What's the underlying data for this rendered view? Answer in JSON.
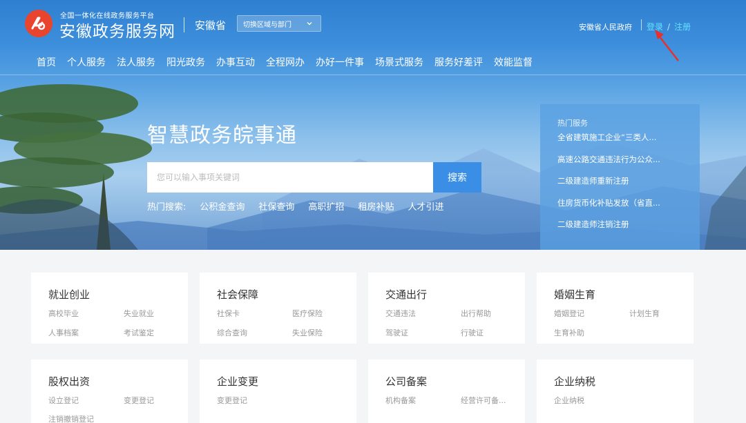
{
  "header": {
    "logo_subtitle": "全国一体化在线政务服务平台",
    "logo_title": "安徽政务服务网",
    "province": "安徽省",
    "region_switch": "切换区域与部门",
    "gov_link": "安徽省人民政府",
    "login": "登录",
    "register": "注册",
    "separator": "/"
  },
  "nav": [
    "首页",
    "个人服务",
    "法人服务",
    "阳光政务",
    "办事互动",
    "全程网办",
    "办好一件事",
    "场景式服务",
    "服务好差评",
    "效能监督"
  ],
  "hero": {
    "title": "智慧政务皖事通",
    "search_placeholder": "您可以输入事项关键词",
    "search_button": "搜索",
    "hot_label": "热门搜索:",
    "hot_terms": [
      "公积金查询",
      "社保查询",
      "高职扩招",
      "租房补贴",
      "人才引进"
    ]
  },
  "hot_services": {
    "title": "热门服务",
    "items": [
      "全省建筑施工企业“三类人...",
      "高速公路交通违法行为公众...",
      "二级建造师重新注册",
      "住房货币化补贴发放（省直...",
      "二级建造师注销注册"
    ]
  },
  "cards": [
    {
      "title": "就业创业",
      "links": [
        "高校毕业",
        "失业就业",
        "人事档案",
        "考试鉴定"
      ]
    },
    {
      "title": "社会保障",
      "links": [
        "社保卡",
        "医疗保险",
        "综合查询",
        "失业保险"
      ]
    },
    {
      "title": "交通出行",
      "links": [
        "交通违法",
        "出行帮助",
        "驾驶证",
        "行驶证"
      ]
    },
    {
      "title": "婚姻生育",
      "links": [
        "婚姻登记",
        "计划生育",
        "生育补助"
      ]
    },
    {
      "title": "股权出资",
      "links": [
        "设立登记",
        "变更登记",
        "注销撤销登记"
      ]
    },
    {
      "title": "企业变更",
      "links": [
        "变更登记"
      ]
    },
    {
      "title": "公司备案",
      "links": [
        "机构备案",
        "经营许可备..."
      ]
    },
    {
      "title": "企业纳税",
      "links": [
        "企业纳税"
      ]
    }
  ],
  "colors": {
    "header_blue": "#2f7fd0",
    "search_button": "#3a8ee6",
    "login_link": "#63e1ff",
    "logo_red": "#e8442e",
    "annotation_arrow": "#e8302a"
  }
}
